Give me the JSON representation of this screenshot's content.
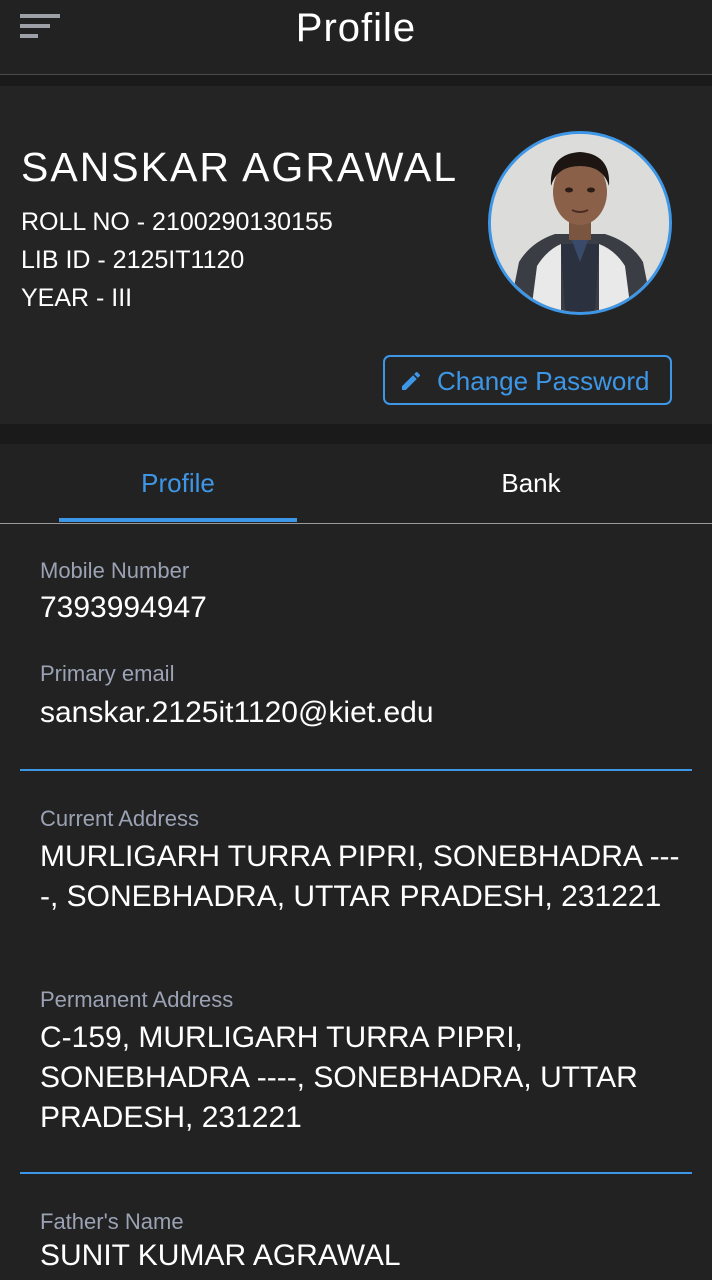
{
  "app_bar": {
    "title": "Profile",
    "menu_icon": "sort-menu-icon"
  },
  "student": {
    "name": "SANSKAR AGRAWAL",
    "roll_no": "ROLL NO - 2100290130155",
    "lib_id": "LIB ID - 2125IT1120",
    "year": "YEAR - III",
    "change_password_label": "Change Password",
    "change_password_icon": "pencil-icon"
  },
  "tabs": [
    {
      "label": "Profile",
      "active": true
    },
    {
      "label": "Bank",
      "active": false
    }
  ],
  "details": {
    "mobile_label": "Mobile Number",
    "mobile_value": "7393994947",
    "email_label": "Primary email",
    "email_value": "sanskar.2125it1120@kiet.edu",
    "current_address_label": "Current Address",
    "current_address_value": "MURLIGARH TURRA PIPRI, SONEBHADRA ----, SONEBHADRA, UTTAR PRADESH, 231221",
    "permanent_address_label": "Permanent Address",
    "permanent_address_value": "C-159, MURLIGARH TURRA PIPRI, SONEBHADRA ----, SONEBHADRA, UTTAR PRADESH, 231221",
    "father_name_label": "Father's Name",
    "father_name_value": "SUNIT KUMAR AGRAWAL"
  },
  "colors": {
    "accent": "#3d97e6",
    "background": "#222222",
    "label": "#9aa2b4"
  }
}
